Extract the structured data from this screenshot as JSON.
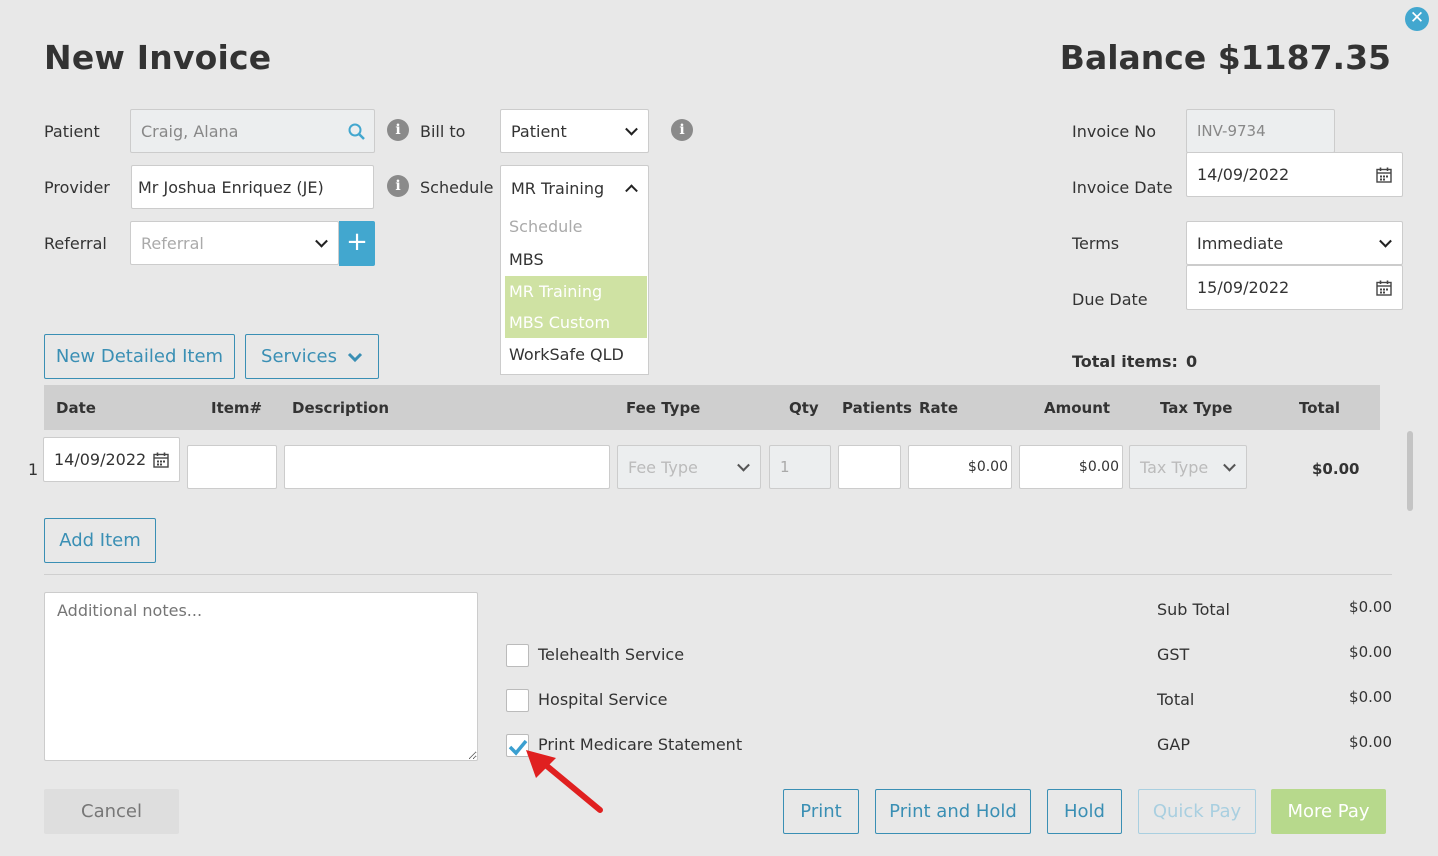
{
  "header": {
    "title": "New Invoice",
    "balance": "Balance $1187.35",
    "close_glyph": "✕"
  },
  "form": {
    "patient": {
      "label": "Patient",
      "value": "Craig, Alana"
    },
    "provider": {
      "label": "Provider",
      "value": "Mr Joshua Enriquez (JE)"
    },
    "referral": {
      "label": "Referral",
      "placeholder": "Referral",
      "add_glyph": "+"
    },
    "bill_to": {
      "label": "Bill to",
      "value": "Patient"
    },
    "schedule": {
      "label": "Schedule",
      "value": "MR Training",
      "options": [
        "Schedule",
        "MBS",
        "MR Training",
        "MBS Custom",
        "WorkSafe QLD"
      ]
    },
    "invoice_no": {
      "label": "Invoice No",
      "value": "INV-9734"
    },
    "invoice_date": {
      "label": "Invoice Date",
      "value": "14/09/2022"
    },
    "terms": {
      "label": "Terms",
      "value": "Immediate"
    },
    "due_date": {
      "label": "Due Date",
      "value": "15/09/2022"
    },
    "total_items": {
      "label": "Total items:",
      "value": "0"
    }
  },
  "toolbar": {
    "new_detailed_item": "New Detailed Item",
    "services": "Services"
  },
  "table": {
    "headers": [
      "Date",
      "Item#",
      "Description",
      "Fee Type",
      "Qty",
      "Patients",
      "Rate",
      "Amount",
      "Tax Type",
      "Total"
    ],
    "rows": [
      {
        "num": "1",
        "date": "14/09/2022",
        "item": "",
        "description": "",
        "fee_type": "Fee Type",
        "qty": "1",
        "patients": "",
        "rate": "$0.00",
        "amount": "$0.00",
        "tax_type": "Tax Type",
        "total": "$0.00"
      }
    ],
    "add_item": "Add Item"
  },
  "notes": {
    "placeholder": "Additional notes..."
  },
  "options": {
    "telehealth": {
      "label": "Telehealth Service",
      "checked": false
    },
    "hospital": {
      "label": "Hospital Service",
      "checked": false
    },
    "medicare": {
      "label": "Print Medicare Statement",
      "checked": true
    }
  },
  "summary": {
    "sub_total": {
      "label": "Sub Total",
      "value": "$0.00"
    },
    "gst": {
      "label": "GST",
      "value": "$0.00"
    },
    "total": {
      "label": "Total",
      "value": "$0.00"
    },
    "gap": {
      "label": "GAP",
      "value": "$0.00"
    }
  },
  "footer": {
    "cancel": "Cancel",
    "print": "Print",
    "print_hold": "Print and Hold",
    "hold": "Hold",
    "quick_pay": "Quick Pay",
    "more_pay": "More Pay"
  },
  "colors": {
    "accent": "#3a8fb4",
    "highlight": "#cfe2a3",
    "more_pay": "#b7d98c",
    "arrow": "#e02020"
  },
  "icons": [
    "close-icon",
    "search-icon",
    "info-icon",
    "chevron-down-icon",
    "chevron-up-icon",
    "plus-icon",
    "calendar-icon",
    "check-icon",
    "resize-handle-icon",
    "arrow-annotation"
  ]
}
